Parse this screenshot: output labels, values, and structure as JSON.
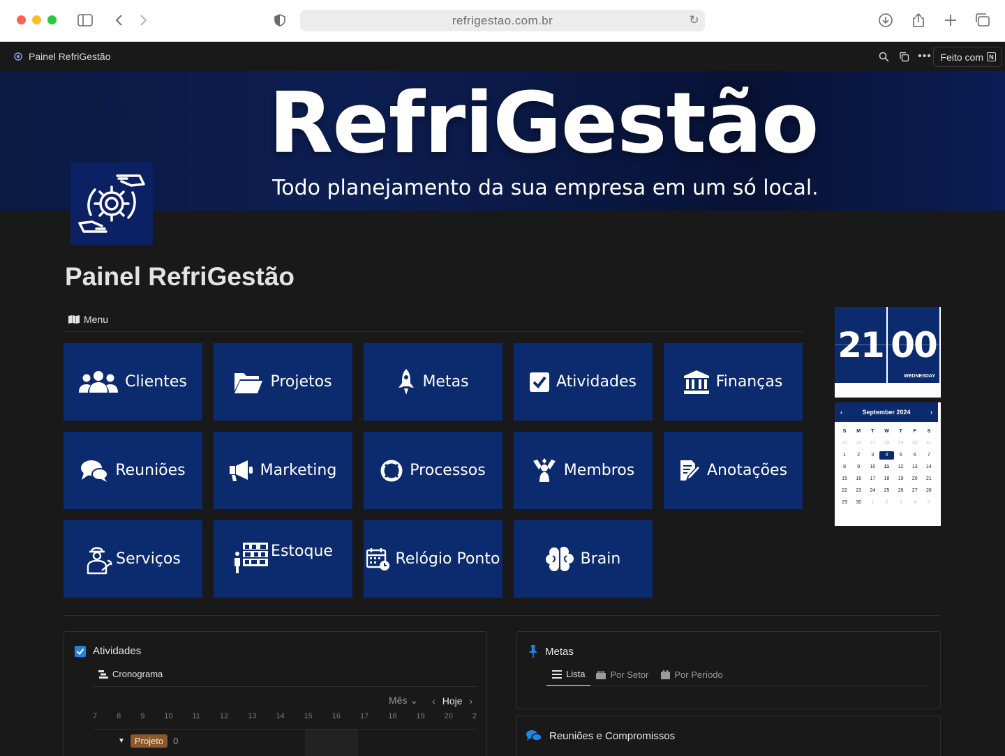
{
  "browser": {
    "url": "refrigestao.com.br"
  },
  "topbar": {
    "breadcrumb": "Painel RefriGestão",
    "made_with": "Feito com"
  },
  "cover": {
    "title": "RefriGestão",
    "subtitle": "Todo planejamento da sua empresa em um só local."
  },
  "page": {
    "title": "Painel RefriGestão",
    "menu_label": "Menu"
  },
  "tiles": [
    {
      "label": "Clientes",
      "icon": "users-icon"
    },
    {
      "label": "Projetos",
      "icon": "folder-open-icon"
    },
    {
      "label": "Metas",
      "icon": "rocket-icon"
    },
    {
      "label": "Atividades",
      "icon": "checkbox-icon"
    },
    {
      "label": "Finanças",
      "icon": "bank-icon"
    },
    {
      "label": "Reuniões",
      "icon": "chat-bubbles-icon"
    },
    {
      "label": "Marketing",
      "icon": "megaphone-icon"
    },
    {
      "label": "Processos",
      "icon": "lifebuoy-icon"
    },
    {
      "label": "Membros",
      "icon": "team-icon"
    },
    {
      "label": "Anotações",
      "icon": "note-pen-icon"
    },
    {
      "label": "Serviços",
      "icon": "technician-icon"
    },
    {
      "label": "Estoque",
      "icon": "warehouse-icon"
    },
    {
      "label": "Relógio Ponto",
      "icon": "calendar-clock-icon"
    },
    {
      "label": "Brain",
      "icon": "brain-icon"
    }
  ],
  "colors": {
    "tile_bg": "#0c2a6e",
    "page_bg": "#191919",
    "accent_blue": "#2383e2"
  },
  "clock": {
    "hours": "21",
    "minutes": "00",
    "weekday": "WEDNESDAY"
  },
  "calendar": {
    "month": "September 2024",
    "weekdays": [
      "S",
      "M",
      "T",
      "W",
      "T",
      "F",
      "S"
    ],
    "weeks": [
      [
        "25",
        "26",
        "27",
        "28",
        "29",
        "30",
        "31"
      ],
      [
        "1",
        "2",
        "3",
        "4",
        "5",
        "6",
        "7"
      ],
      [
        "8",
        "9",
        "10",
        "11",
        "12",
        "13",
        "14"
      ],
      [
        "15",
        "16",
        "17",
        "18",
        "19",
        "20",
        "21"
      ],
      [
        "22",
        "23",
        "24",
        "25",
        "26",
        "27",
        "28"
      ],
      [
        "29",
        "30",
        "1",
        "2",
        "3",
        "4",
        "5"
      ]
    ],
    "selected": "4"
  },
  "activities": {
    "title": "Atividades",
    "view": "Cronograma",
    "period": "Mês",
    "today": "Hoje",
    "days": [
      "7",
      "8",
      "9",
      "10",
      "11",
      "12",
      "13",
      "14",
      "15",
      "16",
      "17",
      "18",
      "19",
      "20",
      "2"
    ],
    "group_label": "Projeto",
    "group_count": "0"
  },
  "goals": {
    "title": "Metas",
    "tabs": [
      "Lista",
      "Por Setor",
      "Por Período"
    ]
  },
  "meetings": {
    "title": "Reuniões e Compromissos"
  }
}
